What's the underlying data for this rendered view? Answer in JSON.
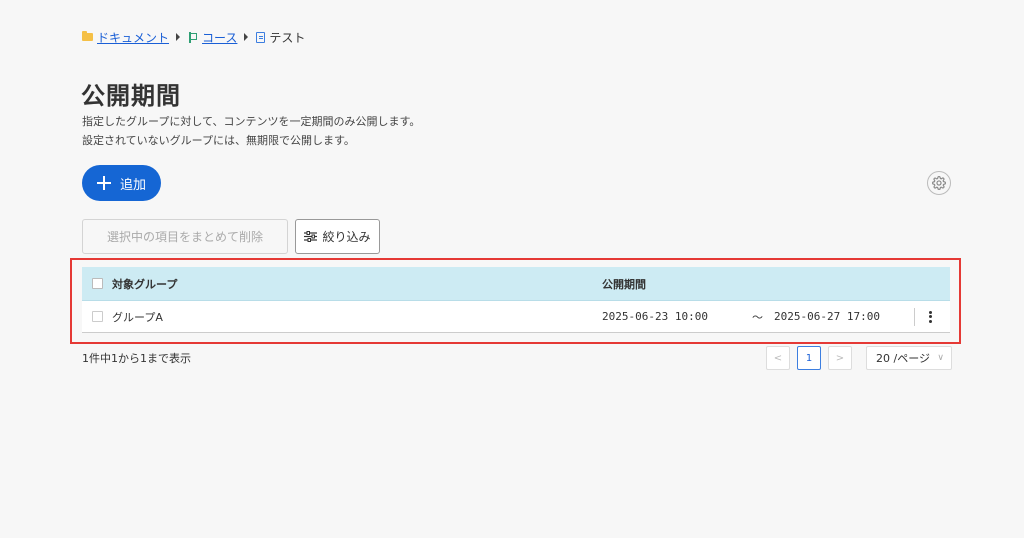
{
  "breadcrumb": {
    "items": [
      {
        "label": "ドキュメント",
        "icon": "folder-icon"
      },
      {
        "label": "コース",
        "icon": "flag-icon"
      },
      {
        "label": "テスト",
        "icon": "document-icon"
      }
    ]
  },
  "page": {
    "title": "公開期間",
    "description_1": "指定したグループに対して、コンテンツを一定期間のみ公開します。",
    "description_2": "設定されていないグループには、無期限で公開します。"
  },
  "toolbar": {
    "add_label": "追加",
    "bulk_delete_label": "選択中の項目をまとめて削除",
    "filter_label": "絞り込み"
  },
  "table": {
    "headers": {
      "group": "対象グループ",
      "period": "公開期間"
    },
    "rows": [
      {
        "group": "グループA",
        "start": "2025-06-23 10:00",
        "tilde": "～",
        "end": "2025-06-27 17:00"
      }
    ]
  },
  "pagination": {
    "summary": "1件中1から1まで表示",
    "prev": "<",
    "current": "1",
    "next": ">",
    "per_page": "20 /ページ"
  },
  "colors": {
    "primary": "#1566d4",
    "header_bg": "#cdebf3",
    "highlight": "#e53935"
  }
}
